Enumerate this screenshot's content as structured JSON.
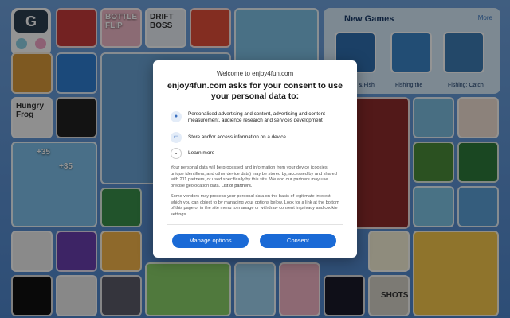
{
  "consent": {
    "site_label": "Welcome to enjoy4fun.com",
    "headline": "enjoy4fun.com asks for your consent to use your personal data to:",
    "purposes": [
      {
        "icon": "person-icon",
        "text": "Personalised advertising and content, advertising and content measurement, audience research and services development"
      },
      {
        "icon": "device-icon",
        "text": "Store and/or access information on a device"
      }
    ],
    "learn_more": "Learn more",
    "paragraph1": "Your personal data will be processed and information from your device (cookies, unique identifiers, and other device data) may be stored by, accessed by and shared with 211 partners, or used specifically by this site. We and our partners may use precise geolocation data.",
    "partners_link": "List of partners.",
    "paragraph2": "Some vendors may process your personal data on the basis of legitimate interest, which you can object to by managing your options below. Look for a link at the bottom of this page or in the site menu to manage or withdraw consent in privacy and cookie settings.",
    "manage_button": "Manage options",
    "consent_button": "Consent"
  },
  "background": {
    "new_games": {
      "title": "New Games",
      "more": "More",
      "items": [
        "& Fish",
        "Fishing the",
        "Fishing: Catch"
      ]
    },
    "tile_captions": {
      "bottle": "BOTTLE FLIP",
      "drift": "DRIFT BOSS",
      "hungry": "Hungry Frog",
      "run35a": "+35",
      "run35b": "+35",
      "shots": "SHOTS"
    }
  },
  "colors": {
    "accent": "#1a6ad6",
    "page_bg": "#4f86cc",
    "panel": "#d7ecfb"
  }
}
